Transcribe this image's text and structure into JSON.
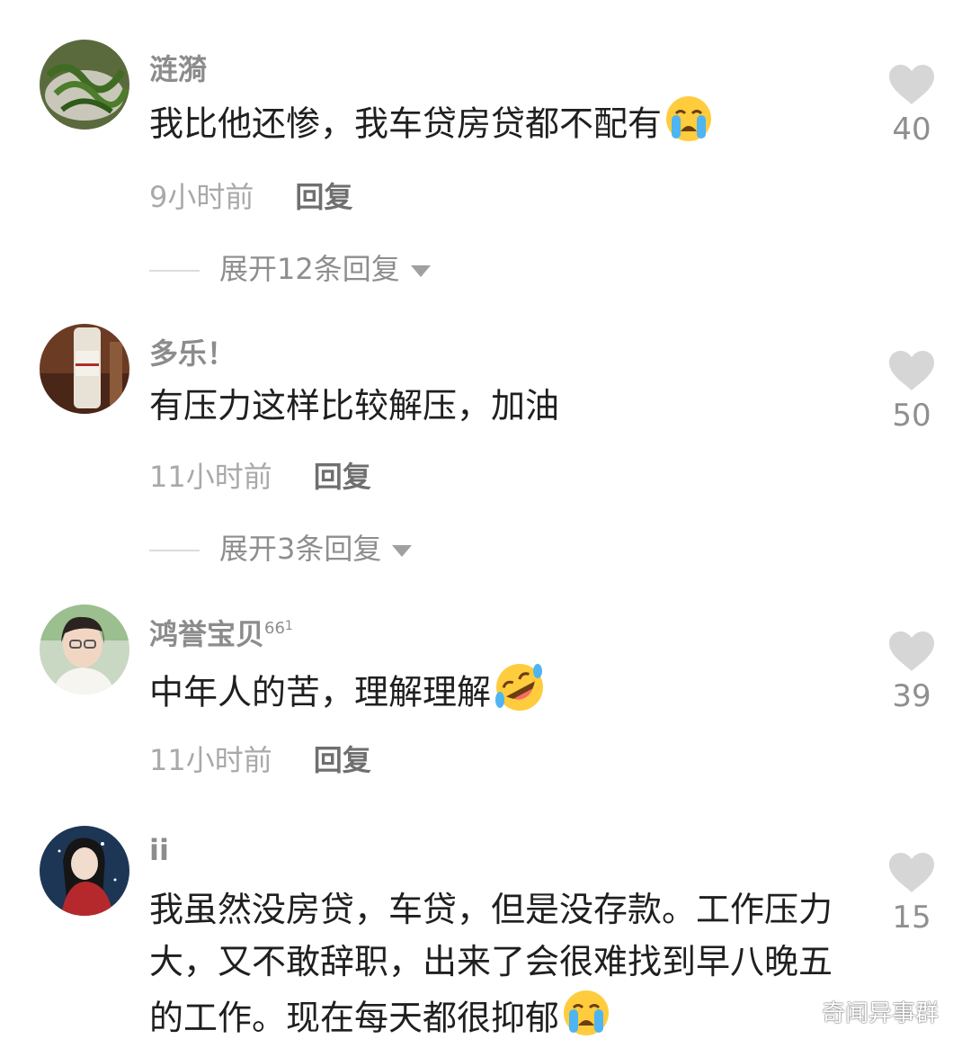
{
  "comments": [
    {
      "username": "涟漪",
      "badge": "",
      "text": "我比他还惨，我车贷房贷都不配有",
      "emoji": "loudly-crying-face",
      "time": "9小时前",
      "reply_label": "回复",
      "expand_label": "展开12条回复",
      "likes": "40"
    },
    {
      "username": "多乐！",
      "badge": "",
      "text": "有压力这样比较解压，加油",
      "emoji": "",
      "time": "11小时前",
      "reply_label": "回复",
      "expand_label": "展开3条回复",
      "likes": "50"
    },
    {
      "username": "鸿誉宝贝",
      "badge": "66",
      "badge_sup": "1",
      "text": "中年人的苦，理解理解",
      "emoji": "rolling-on-floor-laughing",
      "time": "11小时前",
      "reply_label": "回复",
      "likes": "39"
    },
    {
      "username": "ii",
      "badge": "",
      "text": "我虽然没房贷，车贷，但是没存款。工作压力大，又不敢辞职，出来了会很难找到早八晚五的工作。现在每天都很抑郁",
      "emoji": "loudly-crying-face",
      "likes": "15"
    }
  ],
  "watermark": "奇闻异事群",
  "colors": {
    "like_gray": "#d6d6d6",
    "text_dark": "#1f1f1f",
    "meta_gray": "#a9a9a9"
  }
}
